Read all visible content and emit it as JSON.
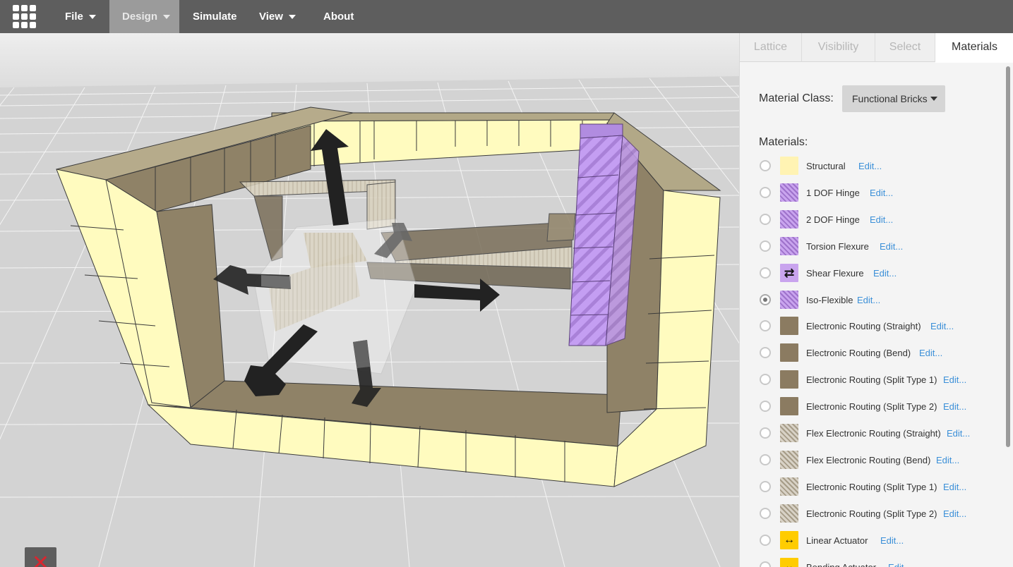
{
  "navbar": {
    "menu": [
      {
        "label": "File",
        "has_caret": true
      },
      {
        "label": "Design",
        "has_caret": true,
        "active": true
      },
      {
        "label": "Simulate",
        "has_caret": false
      },
      {
        "label": "View",
        "has_caret": true
      },
      {
        "label": "About",
        "has_caret": false
      }
    ],
    "logo_icon": "grid-logo-icon"
  },
  "viewport": {
    "scene": "3d-lattice-design",
    "close_button_icon": "close-icon",
    "colors": {
      "structural": "#fffbbf",
      "routing": "#b1a585",
      "hinge": "#c29cf0",
      "floor": "#d4d4d4",
      "arrow": "#222222"
    }
  },
  "panel": {
    "tabs": [
      {
        "label": "Lattice"
      },
      {
        "label": "Visibility"
      },
      {
        "label": "Select"
      },
      {
        "label": "Materials",
        "active": true
      }
    ],
    "material_class_label": "Material Class:",
    "material_class_value": "Functional Bricks",
    "materials_label": "Materials:",
    "edit_label": "Edit...",
    "materials": [
      {
        "name": "Structural",
        "swatch": "structural",
        "checked": false
      },
      {
        "name": "1 DOF Hinge",
        "swatch": "hinge",
        "checked": false
      },
      {
        "name": "2 DOF Hinge",
        "swatch": "hinge",
        "checked": false
      },
      {
        "name": "Torsion Flexure",
        "swatch": "hinge",
        "checked": false
      },
      {
        "name": "Shear Flexure",
        "swatch": "shear",
        "checked": false
      },
      {
        "name": "Iso-Flexible",
        "swatch": "hinge",
        "checked": true
      },
      {
        "name": "Electronic Routing (Straight)",
        "swatch": "brown",
        "checked": false
      },
      {
        "name": "Electronic Routing (Bend)",
        "swatch": "brown",
        "checked": false
      },
      {
        "name": "Electronic Routing (Split Type 1)",
        "swatch": "brown",
        "checked": false
      },
      {
        "name": "Electronic Routing (Split Type 2)",
        "swatch": "brown",
        "checked": false
      },
      {
        "name": "Flex Electronic Routing (Straight)",
        "swatch": "flex",
        "checked": false
      },
      {
        "name": "Flex Electronic Routing (Bend)",
        "swatch": "flex",
        "checked": false
      },
      {
        "name": "Electronic Routing (Split Type 1)",
        "swatch": "flex",
        "checked": false
      },
      {
        "name": "Electronic Routing (Split Type 2)",
        "swatch": "flex",
        "checked": false
      },
      {
        "name": "Linear Actuator",
        "swatch": "actuator",
        "checked": false
      },
      {
        "name": "Bending Actuator",
        "swatch": "actuator",
        "checked": false
      }
    ]
  }
}
